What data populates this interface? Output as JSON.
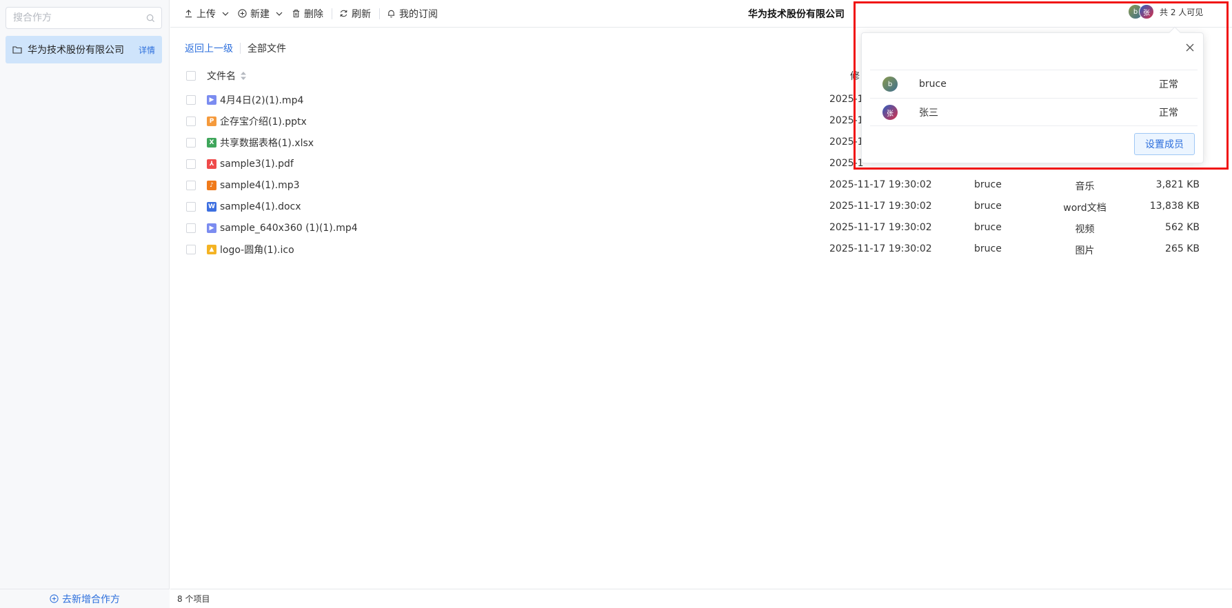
{
  "sidebar": {
    "search_placeholder": "搜合作方",
    "items": [
      {
        "label": "华为技术股份有限公司",
        "detail": "详情"
      }
    ],
    "add_label": "去新增合作方"
  },
  "toolbar": {
    "upload": "上传",
    "new": "新建",
    "delete": "删除",
    "refresh": "刷新",
    "subscriptions": "我的订阅",
    "company": "华为技术股份有限公司",
    "visible_count": "共 2 人可见",
    "avatars": [
      {
        "initial": "b"
      },
      {
        "initial": "张"
      }
    ]
  },
  "breadcrumb": {
    "back": "返回上一级",
    "all": "全部文件"
  },
  "table": {
    "header_name": "文件名",
    "header_modified_partial": "修",
    "rows": [
      {
        "icon": "video-file-icon",
        "icon_char": "▶",
        "color": "#7b8cf0",
        "name": "4月4日(2)(1).mp4",
        "time": "2025-1",
        "owner": "",
        "type": "",
        "size": ""
      },
      {
        "icon": "ppt-file-icon",
        "icon_char": "P",
        "color": "#f59a3c",
        "name": "企存宝介绍(1).pptx",
        "time": "2025-1",
        "owner": "",
        "type": "",
        "size": ""
      },
      {
        "icon": "excel-file-icon",
        "icon_char": "X",
        "color": "#3fa65b",
        "name": "共享数据表格(1).xlsx",
        "time": "2025-1",
        "owner": "",
        "type": "",
        "size": ""
      },
      {
        "icon": "pdf-file-icon",
        "icon_char": "⅄",
        "color": "#ef4a4a",
        "name": "sample3(1).pdf",
        "time": "2025-1",
        "owner": "",
        "type": "",
        "size": ""
      },
      {
        "icon": "audio-file-icon",
        "icon_char": "♪",
        "color": "#f07a1a",
        "name": "sample4(1).mp3",
        "time": "2025-11-17 19:30:02",
        "owner": "bruce",
        "type": "音乐",
        "size": "3,821 KB"
      },
      {
        "icon": "word-file-icon",
        "icon_char": "W",
        "color": "#3d6fe0",
        "name": "sample4(1).docx",
        "time": "2025-11-17 19:30:02",
        "owner": "bruce",
        "type": "word文档",
        "size": "13,838 KB"
      },
      {
        "icon": "video-file-icon",
        "icon_char": "▶",
        "color": "#7b8cf0",
        "name": "sample_640x360 (1)(1).mp4",
        "time": "2025-11-17 19:30:02",
        "owner": "bruce",
        "type": "视频",
        "size": "562 KB"
      },
      {
        "icon": "image-file-icon",
        "icon_char": "▲",
        "color": "#f4b323",
        "name": "logo-圆角(1).ico",
        "time": "2025-11-17 19:30:02",
        "owner": "bruce",
        "type": "图片",
        "size": "265 KB"
      }
    ]
  },
  "status": {
    "count": "8 个项目"
  },
  "popover": {
    "members": [
      {
        "initial": "b",
        "name": "bruce",
        "status": "正常"
      },
      {
        "initial": "张",
        "name": "张三",
        "status": "正常"
      }
    ],
    "set_button": "设置成员"
  }
}
